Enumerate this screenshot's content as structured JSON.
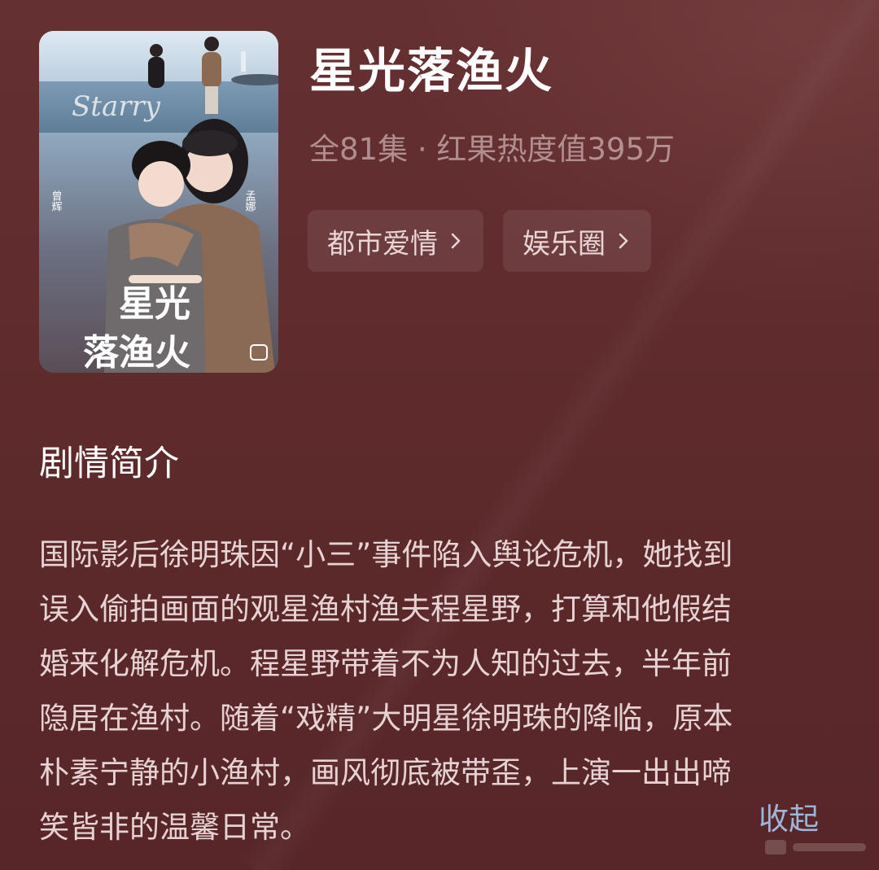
{
  "show": {
    "title": "星光落渔火",
    "meta": "全81集 · 红果热度值395万",
    "tags": [
      {
        "label": "都市爱情",
        "icon": "chevron-right-icon"
      },
      {
        "label": "娱乐圈",
        "icon": "chevron-right-icon"
      }
    ]
  },
  "poster": {
    "title_art": "星光落渔火",
    "cast_left": "曾辉",
    "cast_right": "孟娜",
    "script_text": "Starry"
  },
  "synopsis": {
    "heading": "剧情简介",
    "lines": [
      "国际影后徐明珠因“小三”事件陷入舆论危机，她找到",
      "误入偷拍画面的观星渔村渔夫程星野，打算和他假结",
      "婚来化解危机。程星野带着不为人知的过去，半年前",
      "隐居在渔村。随着“戏精”大明星徐明珠的降临，原本",
      "朴素宁静的小渔村，画风彻底被带歪，上演一出出啼",
      "笑皆非的温馨日常。"
    ],
    "collapse_label": "收起"
  },
  "colors": {
    "background": "#5f2b2d",
    "link": "#9fb6d9",
    "title": "#ffffff"
  }
}
